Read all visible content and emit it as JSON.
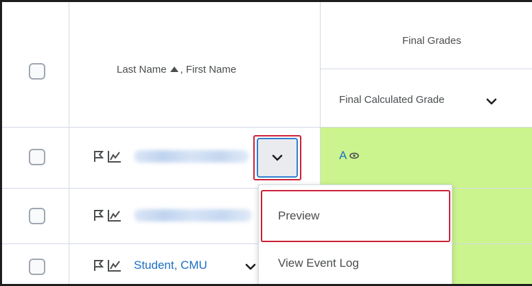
{
  "header": {
    "name_col_last": "Last Name",
    "name_col_first": ", First Name",
    "group_title": "Final Grades",
    "grade_col": "Final Calculated Grade"
  },
  "rows": [
    {
      "name": "",
      "grade": "A",
      "name_blurred": true
    },
    {
      "name": "",
      "grade": "",
      "name_blurred": true
    },
    {
      "name": "Student, CMU",
      "grade": "",
      "name_blurred": false
    }
  ],
  "context_menu": {
    "items": [
      {
        "label": "Preview",
        "highlighted": true
      },
      {
        "label": "View Event Log",
        "highlighted": false
      }
    ]
  },
  "icons": {
    "flag": "flag-icon",
    "stats": "grade-statistics-icon",
    "chevron": "chevron-down-icon",
    "sort": "sort-ascending-icon",
    "visibility": "eye-icon"
  },
  "colors": {
    "grade_cell_bg": "#ccf48e",
    "link": "#1a6fc4",
    "highlight_outline": "#cc1f36",
    "focus_outline": "#2f7fd0"
  }
}
